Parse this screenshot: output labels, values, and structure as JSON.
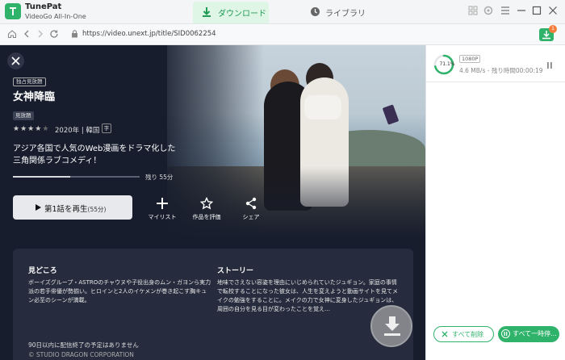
{
  "app": {
    "name": "TunePat",
    "subtitle": "VideoGo All-In-One"
  },
  "tabs": [
    {
      "label": "ダウンロード",
      "active": true
    },
    {
      "label": "ライブラリ",
      "active": false
    }
  ],
  "address": {
    "url": "https://video.unext.jp/title/SID0062254"
  },
  "download_badge": "1",
  "video": {
    "exclusive_badge": "独占見放題",
    "title": "女神降臨",
    "unlimited_badge": "見放題",
    "rating": 4,
    "rating_max": 5,
    "meta": "2020年 | 韓国",
    "subtitle_badge": "字",
    "description": "アジア各国で人気のWeb漫画をドラマ化した三角関係ラブコメディ！",
    "progress_fraction": 0.45,
    "remaining": "残り 55分",
    "play_label": "第1話を再生",
    "play_duration": "(55分)",
    "actions": [
      {
        "label": "マイリスト",
        "icon": "plus-icon"
      },
      {
        "label": "作品を評価",
        "icon": "star-icon"
      },
      {
        "label": "シェア",
        "icon": "share-icon"
      }
    ],
    "highlights_heading": "見どころ",
    "highlights_text": "ボーイズグループ・ASTROのチャウヌや子役出身のムン・ガヨンら実力派の若手俳優が勢揃い。ヒロインと2人のイケメンが巻き起こす胸キュン必至のシーンが満載。",
    "story_heading": "ストーリー",
    "story_text": "地味でさえない容姿を理由にいじめられていたジュギョン。家庭の事情で転校することになった彼女は、人生を変えようと動画サイトを見てメイクの勉強をすることに。メイクの力で女神に変身したジュギョンは、周囲の自分を見る目が変わったことを覚え…",
    "notice": "90日以内に配信終了の予定はありません",
    "copyright": "© STUDIO DRAGON CORPORATION"
  },
  "download": {
    "percent_label": "71.1%",
    "percent": 71.1,
    "resolution": "1080P",
    "speed": "4.6 MB/s - 残り時間00:00:19",
    "delete_all": "すべて削除",
    "pause_all": "すべて一時停..."
  },
  "colors": {
    "accent": "#2fb36b",
    "dark_bg": "#171d2d"
  }
}
